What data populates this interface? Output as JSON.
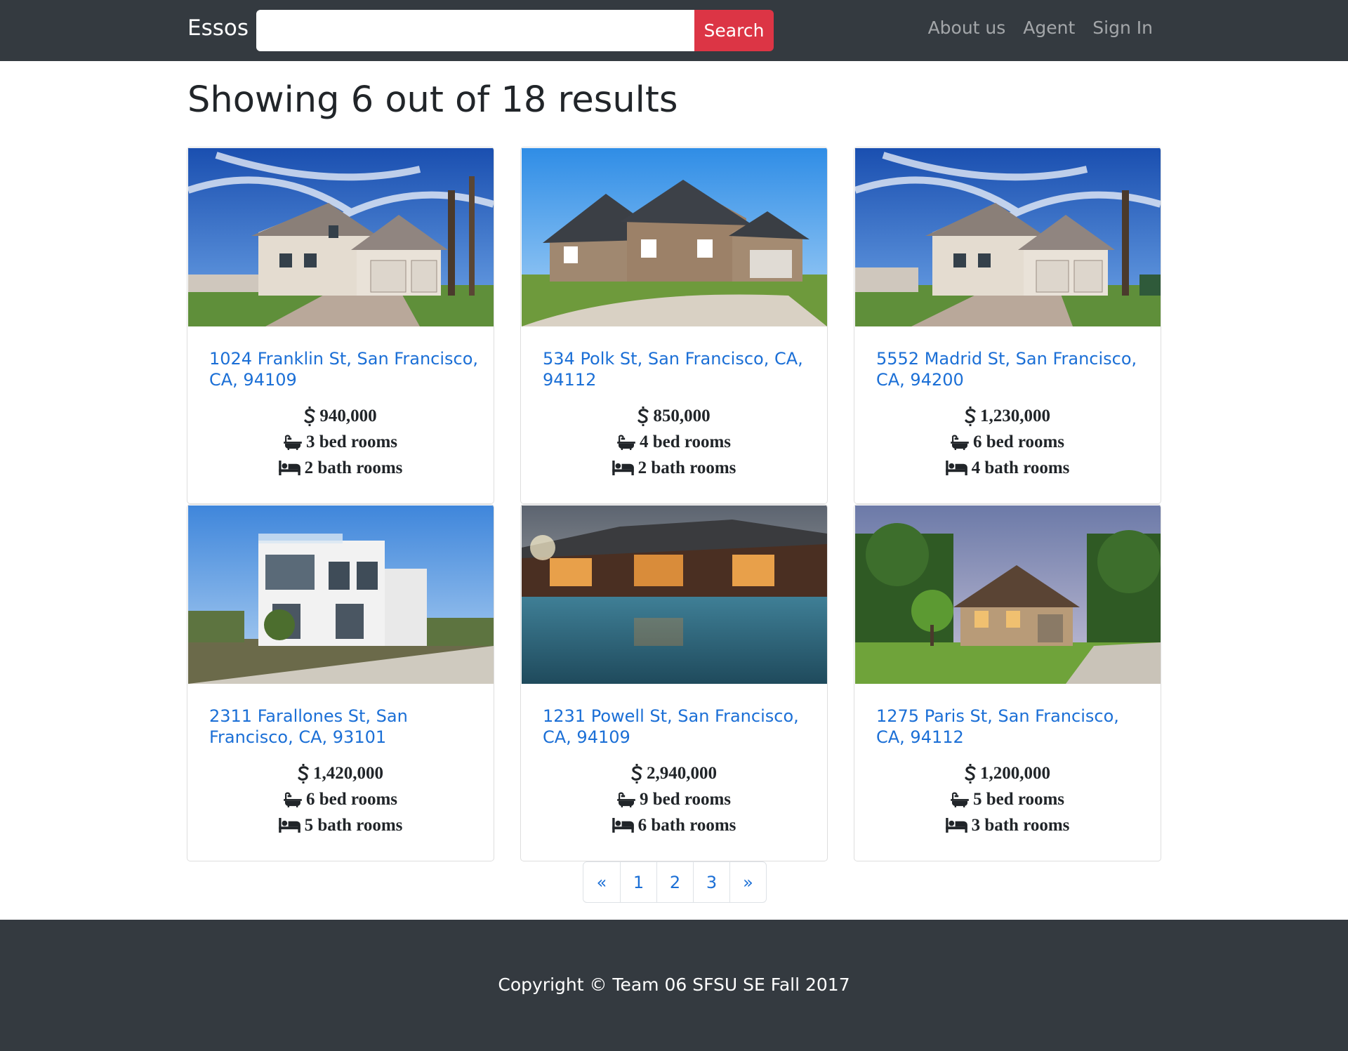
{
  "header": {
    "brand": "Essos",
    "search": {
      "value": "",
      "placeholder": "",
      "button_label": "Search"
    },
    "nav": [
      {
        "label": "About us"
      },
      {
        "label": "Agent"
      },
      {
        "label": "Sign In"
      }
    ]
  },
  "main": {
    "results_heading": "Showing 6 out of 18 results",
    "listings": [
      {
        "address": "1024 Franklin St, San Francisco, CA, 94109",
        "price": "940,000",
        "bed": "3 bed rooms",
        "bath": "2 bath rooms",
        "image": "suburban-house-photo"
      },
      {
        "address": "534 Polk St, San Francisco, CA, 94112",
        "price": "850,000",
        "bed": "4 bed rooms",
        "bath": "2 bath rooms",
        "image": "stone-house-photo"
      },
      {
        "address": "5552 Madrid St, San Francisco, CA, 94200",
        "price": "1,230,000",
        "bed": "6 bed rooms",
        "bath": "4 bath rooms",
        "image": "suburban-house-photo"
      },
      {
        "address": "2311 Farallones St, San Francisco, CA, 93101",
        "price": "1,420,000",
        "bed": "6 bed rooms",
        "bath": "5 bath rooms",
        "image": "modern-white-house-photo"
      },
      {
        "address": "1231 Powell St, San Francisco, CA, 94109",
        "price": "2,940,000",
        "bed": "9 bed rooms",
        "bath": "6 bath rooms",
        "image": "lodge-with-pool-photo"
      },
      {
        "address": "1275 Paris St, San Francisco, CA, 94112",
        "price": "1,200,000",
        "bed": "5 bed rooms",
        "bath": "3 bath rooms",
        "image": "brick-house-lawn-photo"
      }
    ],
    "pagination": [
      "«",
      "1",
      "2",
      "3",
      "»"
    ]
  },
  "footer": {
    "text": "Copyright © Team 06 SFSU SE Fall 2017"
  },
  "colors": {
    "navbar": "#343a40",
    "search_button": "#dc3545",
    "link": "#1b6fd6"
  },
  "icons": {
    "price": "dollar-icon",
    "bed": "bathtub-icon",
    "bath": "bed-icon"
  }
}
